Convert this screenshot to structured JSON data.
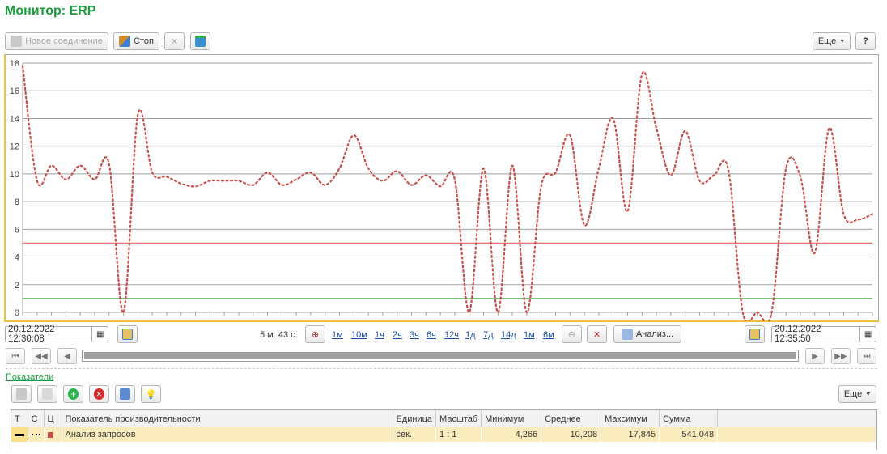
{
  "title": "Монитор: ERP",
  "toolbar": {
    "new_connection": "Новое соединение",
    "stop": "Стоп",
    "more": "Еще",
    "help": "?"
  },
  "chart_data": {
    "type": "line",
    "yticks": [
      "0",
      "2",
      "4",
      "6",
      "8",
      "10",
      "12",
      "14",
      "16",
      "18"
    ],
    "ylim": [
      0,
      18
    ],
    "grid": true,
    "thresholds": [
      {
        "value": 5,
        "color": "#f07070"
      },
      {
        "value": 1,
        "color": "#6ab86a"
      }
    ],
    "series": [
      {
        "color": "#c8504a",
        "style": "dotted",
        "values": [
          17.8,
          9.5,
          10.6,
          9.6,
          10.6,
          9.6,
          10.7,
          0,
          14.3,
          10.1,
          9.8,
          9.3,
          9.1,
          9.5,
          9.5,
          9.5,
          9.2,
          10.1,
          9.2,
          9.6,
          10.1,
          9.2,
          10.4,
          12.8,
          10.4,
          9.5,
          10.2,
          9.2,
          9.9,
          9.1,
          9.6,
          0,
          10.4,
          0,
          10.6,
          0,
          9.1,
          10.1,
          12.8,
          6.3,
          10.4,
          14,
          7.3,
          17.2,
          13.3,
          9.9,
          13.1,
          9.5,
          9.9,
          10.3,
          0,
          0,
          0,
          10.4,
          9.8,
          4.3,
          13.3,
          7.1,
          6.7,
          7.1
        ]
      }
    ]
  },
  "period": {
    "start": "20.12.2022 12:30:08",
    "end": "20.12.2022 12:35:50",
    "duration": "5 м. 43 с.",
    "scales": [
      "1м",
      "10м",
      "1ч",
      "2ч",
      "3ч",
      "6ч",
      "12ч",
      "1д",
      "7д",
      "14д",
      "1м",
      "6м"
    ],
    "analyze": "Анализ..."
  },
  "indicators": {
    "link": "Показатели",
    "more": "Еще",
    "columns": [
      "Т",
      "С",
      "Ц",
      "Показатель производительности",
      "Единица",
      "Масштаб",
      "Минимум",
      "Среднее",
      "Максимум",
      "Сумма"
    ],
    "rows": [
      {
        "name": "Анализ запросов",
        "unit": "сек.",
        "scale": "1 : 1",
        "min": "4,266",
        "avg": "10,208",
        "max": "17,845",
        "sum": "541,048",
        "color": "#c8504a"
      }
    ]
  }
}
